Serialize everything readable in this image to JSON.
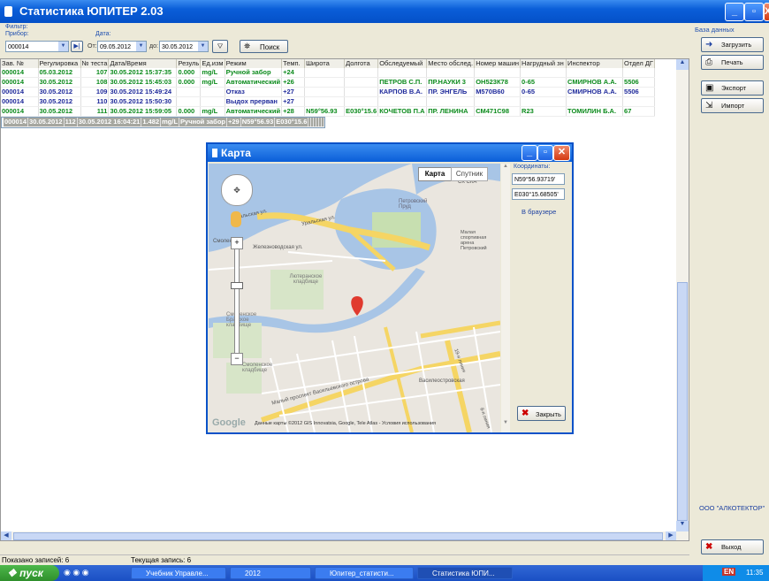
{
  "app": {
    "title": "Статистика ЮПИТЕР 2.03",
    "title_buttons": [
      "_",
      "▫",
      "X"
    ]
  },
  "filter": {
    "label": "Фильтр:",
    "device_label": "Прибор:",
    "device_value": "000014",
    "date_label": "Дата:",
    "from_label": "От:",
    "from_value": "09.05.2012",
    "to_label": "до:",
    "to_value": "30.05.2012",
    "search_label": "Поиск"
  },
  "table": {
    "columns": [
      "Зав. №",
      "Регулировка",
      "№ теста",
      "Дата/Время",
      "Результат",
      "Ед.изм.",
      "Режим",
      "Темп.",
      "Широта",
      "Долгота",
      "Обследуемый",
      "Место обслед.",
      "Номер машины",
      "Нагрудный знак",
      "Инспектор",
      "Отдел ДПС"
    ],
    "column_labels": [
      "Зав. №",
      "Регулировка",
      "№ теста",
      "Дата/Время",
      "Резуль",
      "Ед.изм",
      "Режим",
      "Темп.",
      "Широта",
      "Долгота",
      "Обследуемый",
      "Место обслед.",
      "Номер машин",
      "Нагрудный зн",
      "Инспектор",
      "Отдел ДГ"
    ],
    "rows": [
      {
        "cells": [
          "000014",
          "05.03.2012",
          "107",
          "30.05.2012 15:37:35",
          "0.000",
          "mg/L",
          "Ручной забор",
          "+24",
          "",
          "",
          "",
          "",
          "",
          "",
          "",
          ""
        ],
        "style": "green"
      },
      {
        "cells": [
          "000014",
          "30.05.2012",
          "108",
          "30.05.2012 15:45:03",
          "0.000",
          "mg/L",
          "Автоматический",
          "+26",
          "",
          "",
          "ПЕТРОВ С.П.",
          "ПР.НАУКИ 3",
          "ОН523К78",
          "0-65",
          "СМИРНОВ А.А.",
          "5506"
        ],
        "style": "green"
      },
      {
        "cells": [
          "000014",
          "30.05.2012",
          "109",
          "30.05.2012 15:49:24",
          "",
          "",
          "Отказ",
          "+27",
          "",
          "",
          "КАРПОВ В.А.",
          "ПР. ЭНГЕЛЬ",
          "М570В60",
          "0-65",
          "СМИРНОВ А.А.",
          "5506"
        ],
        "style": "blue"
      },
      {
        "cells": [
          "000014",
          "30.05.2012",
          "110",
          "30.05.2012 15:50:30",
          "",
          "",
          "Выдох прерван",
          "+27",
          "",
          "",
          "",
          "",
          "",
          "",
          "",
          ""
        ],
        "style": "blue"
      },
      {
        "cells": [
          "000014",
          "30.05.2012",
          "111",
          "30.05.2012 15:59:05",
          "0.000",
          "mg/L",
          "Автоматический",
          "+28",
          "N59°56.93",
          "E030°15.6",
          "КОЧЕТОВ П.А",
          "ПР. ЛЕНИНА",
          "СМ471С98",
          "R23",
          "ТОМИЛИН Б.А.",
          "67"
        ],
        "style": "green"
      },
      {
        "cells": [
          "000014",
          "30.05.2012",
          "112",
          "30.05.2012 16:04:21",
          "1.482",
          "mg/L",
          "Ручной забор",
          "+29",
          "N59°56.93",
          "E030°15.6",
          "",
          "",
          "",
          "",
          "",
          ""
        ],
        "style": "sel"
      }
    ]
  },
  "right_panel": {
    "db_label": "База данных",
    "load": "Загрузить",
    "print": "Печать",
    "export": "Экспорт",
    "import": "Импорт",
    "company": "ООО \"АЛКОТЕКТОР\"",
    "exit": "Выход"
  },
  "status": {
    "shown": "Показано записей: 6",
    "current": "Текущая запись: 6"
  },
  "map_window": {
    "title": "Карта",
    "tab_map": "Карта",
    "tab_sat": "Спутник",
    "coords_label": "Координаты:",
    "lat": "N59°56.93719'",
    "lon": "E030°15.68505'",
    "browser_link": "В браузере",
    "close_label": "Закрыть",
    "attribution": "Данные карты ©2012 GIS Innovatsia, Google, Tele Atlas - Условия использования",
    "google": "Google",
    "labels": {
      "uralskaya1": "Уральская ул.",
      "uralskaya2": "Уральская ул.",
      "zheleznovodskaya": "Железноводская ул.",
      "cemetery1": "Лютеранское кладбище",
      "cemetery2": "Смоленское Братское кладбище",
      "cemetery3": "Смоленское кладбище",
      "smolenka": "Смоленка",
      "petrovsky": "Петровский Пруд",
      "stadium": "Малая спортивная арена Петровский",
      "ssk": "СК СКА",
      "malyi": "Малый проспект Васильевского острова",
      "vasileostrovskaya": "Василеостровская",
      "line": "19-я линия",
      "line2": "8-я линия"
    }
  },
  "taskbar": {
    "start": "пуск",
    "tasks": [
      "Учебник Управле...",
      "2012",
      "Юпитер_статисти...",
      "Статистика ЮПИ..."
    ],
    "lang": "EN",
    "clock": "11:35"
  },
  "colors": {
    "green_text": "#0b8a1b",
    "blue_text": "#1f2a9b",
    "title_blue": "#0a5ed8",
    "selected_row": "#a6a7a0"
  }
}
